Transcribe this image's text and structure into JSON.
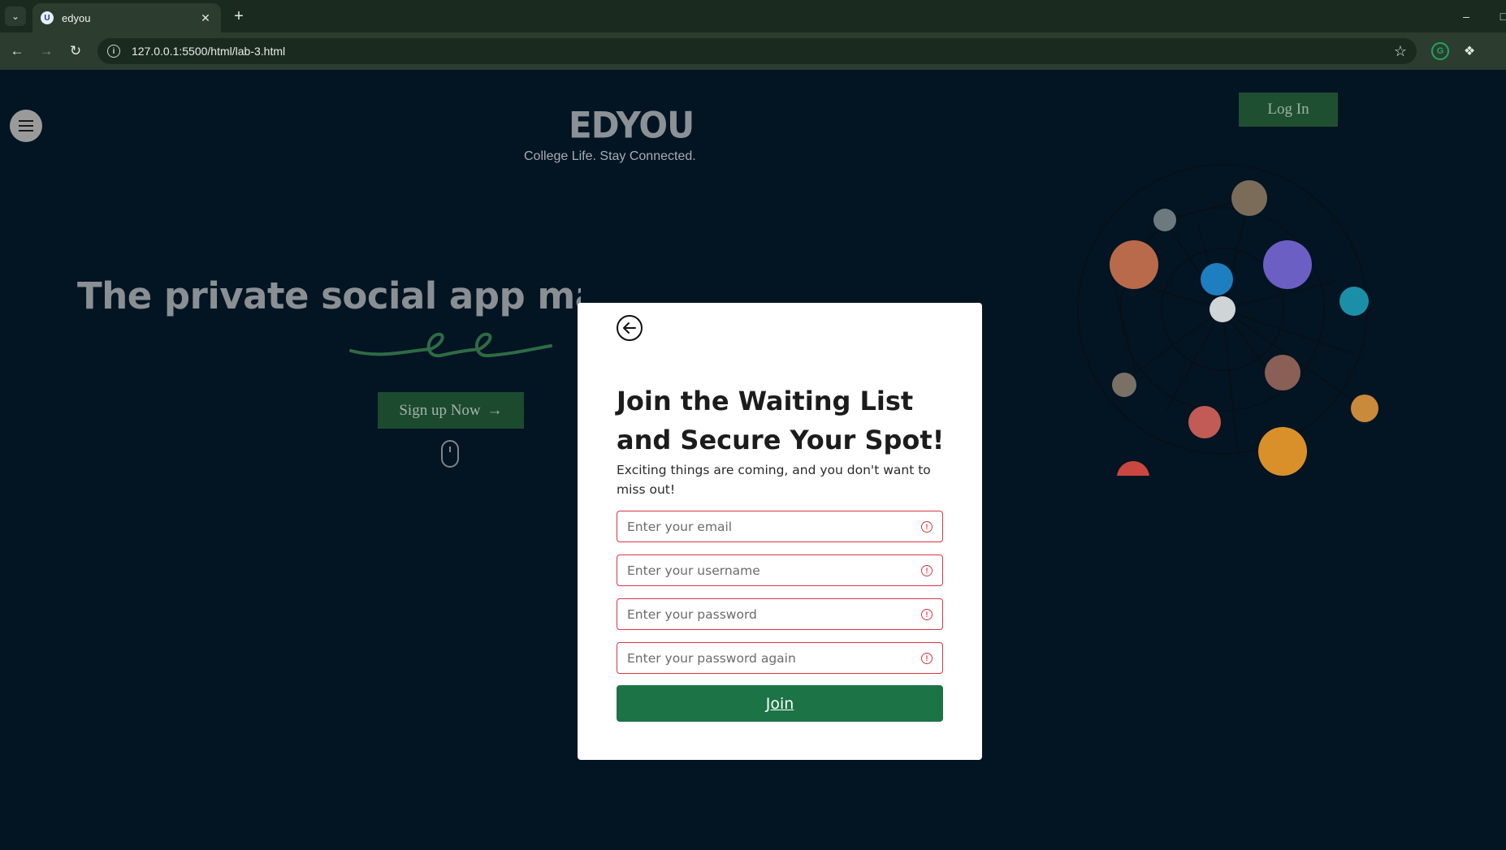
{
  "browser": {
    "tab": {
      "title": "edyou",
      "favicon_icon": "edyou-favicon-icon"
    },
    "url": "127.0.0.1:5500/html/lab-3.html"
  },
  "page": {
    "logo": "EDYOU",
    "tagline": "College Life. Stay Connected.",
    "login_label": "Log In",
    "headline": "The private social app made f",
    "signup_label": "Sign up Now",
    "accent_color": "#1c4a2e"
  },
  "modal": {
    "title": "Join the Waiting List and Secure Your Spot!",
    "subtitle": "Exciting things are coming, and you don't want to miss out!",
    "fields": {
      "email_placeholder": "Enter your email",
      "username_placeholder": "Enter your username",
      "password_placeholder": "Enter your password",
      "password_again_placeholder": "Enter your password again"
    },
    "join_label": "Join",
    "error_color": "#dc3545",
    "button_color": "#1c7346"
  }
}
